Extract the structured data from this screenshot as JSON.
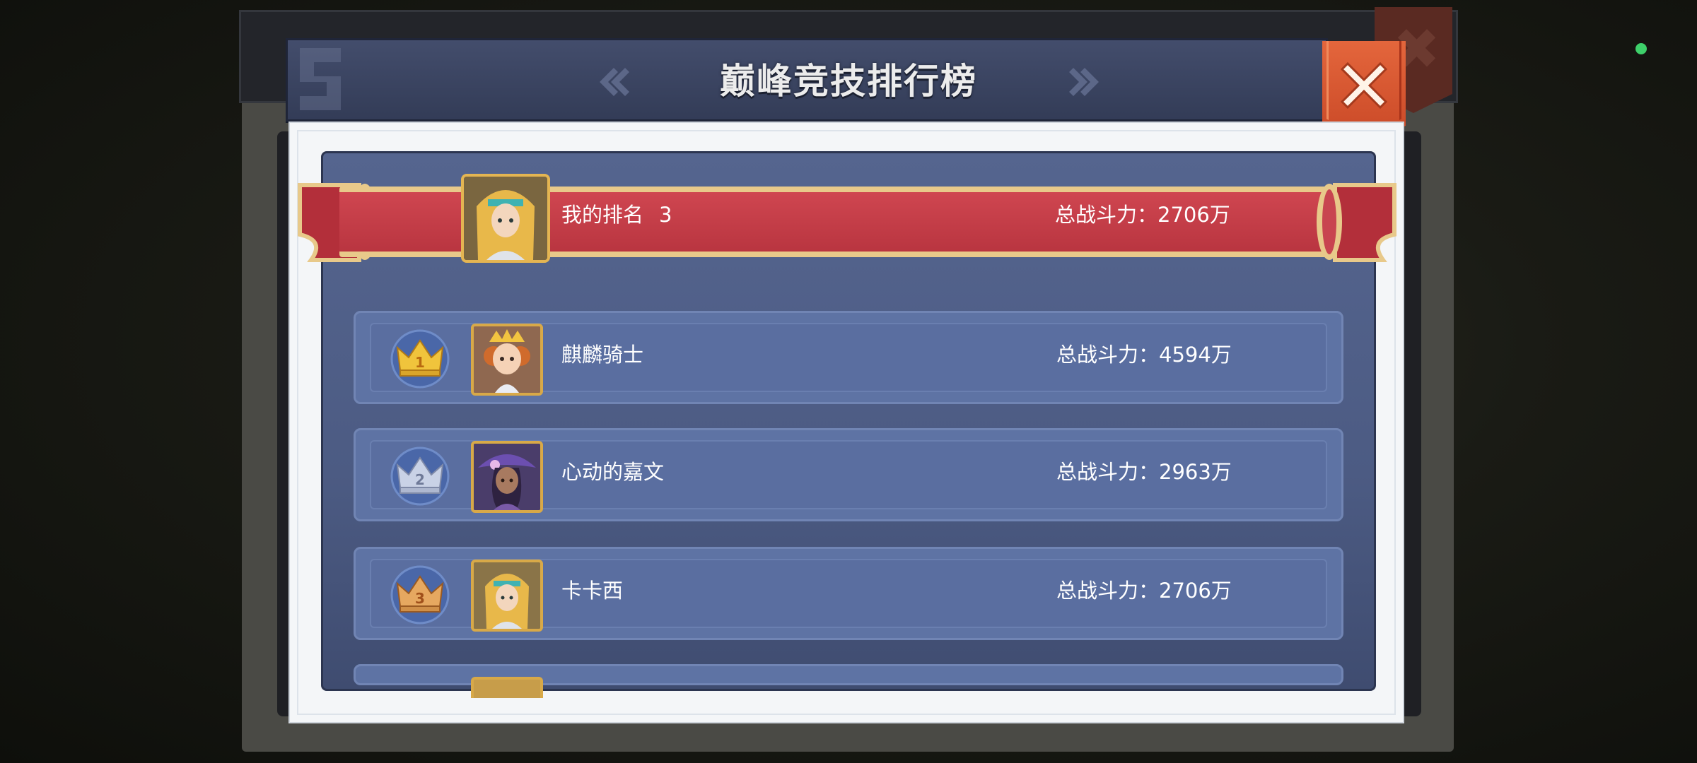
{
  "popup": {
    "title": "巅峰竞技排行榜",
    "close_icon": "close-x-icon",
    "prev_icon": "double-chevron-left-icon",
    "next_icon": "double-chevron-right-icon"
  },
  "my_rank": {
    "label": "我的排名",
    "rank": "3",
    "power": "总战斗力：2706万"
  },
  "leaderboard": [
    {
      "rank": "1",
      "name": "麒麟骑士",
      "power": "总战斗力：4594万",
      "badge": "gold-crown-icon"
    },
    {
      "rank": "2",
      "name": "心动的嘉文",
      "power": "总战斗力：2963万",
      "badge": "silver-crown-icon"
    },
    {
      "rank": "3",
      "name": "卡卡西",
      "power": "总战斗力：2706万",
      "badge": "bronze-crown-icon"
    }
  ],
  "colors": {
    "header": "#3a4462",
    "list_bg": "#4f5e88",
    "row_bg": "#5e73a4",
    "ribbon_red": "#c43d47",
    "close_orange": "#d95530",
    "gold": "#e4b552"
  }
}
